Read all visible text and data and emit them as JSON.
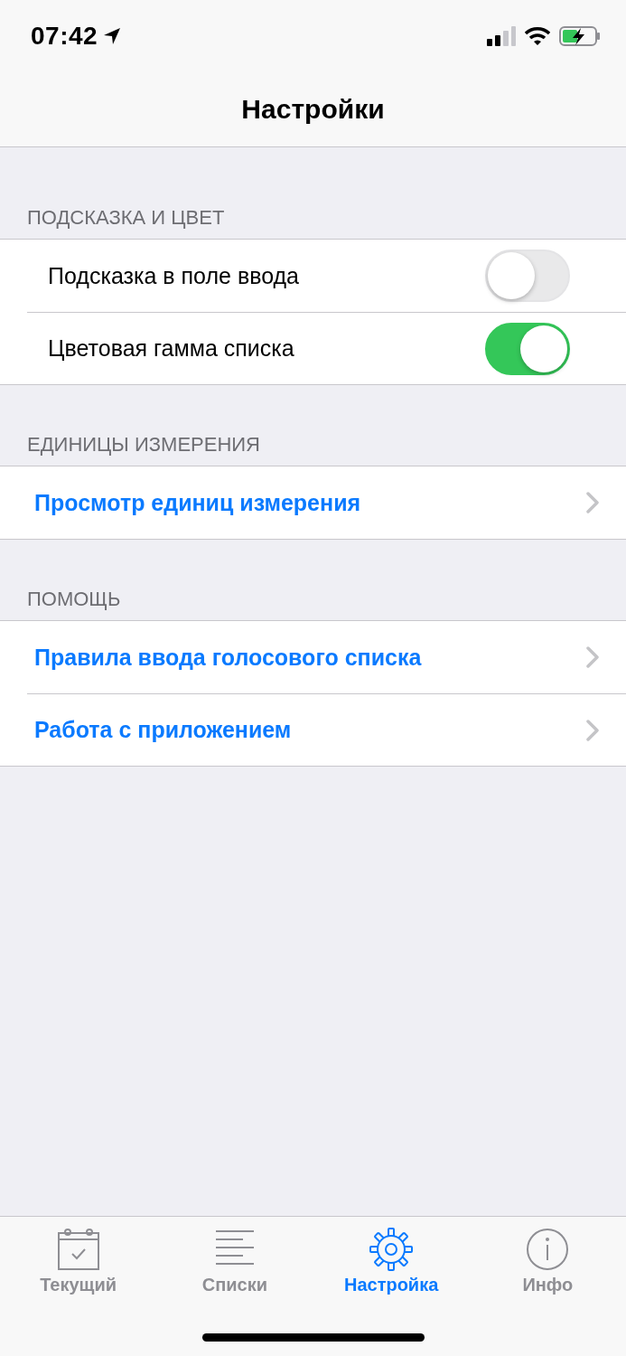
{
  "status_bar": {
    "time": "07:42"
  },
  "nav_bar": {
    "title": "Настройки"
  },
  "sections": [
    {
      "header": "ПОДСКАЗКА И ЦВЕТ",
      "rows": [
        {
          "kind": "toggle",
          "label": "Подсказка в поле ввода",
          "on": false
        },
        {
          "kind": "toggle",
          "label": "Цветовая гамма списка",
          "on": true
        }
      ]
    },
    {
      "header": "ЕДИНИЦЫ ИЗМЕРЕНИЯ",
      "rows": [
        {
          "kind": "link",
          "label": "Просмотр единиц измерения"
        }
      ]
    },
    {
      "header": "ПОМОЩЬ",
      "rows": [
        {
          "kind": "link",
          "label": "Правила ввода голосового списка"
        },
        {
          "kind": "link",
          "label": "Работа с приложением"
        }
      ]
    }
  ],
  "tab_bar": {
    "tabs": [
      {
        "kind": "calendar",
        "label": "Текущий",
        "selected": false
      },
      {
        "kind": "list",
        "label": "Списки",
        "selected": false
      },
      {
        "kind": "gear",
        "label": "Настройка",
        "selected": true
      },
      {
        "kind": "info",
        "label": "Инфо",
        "selected": false
      }
    ]
  }
}
